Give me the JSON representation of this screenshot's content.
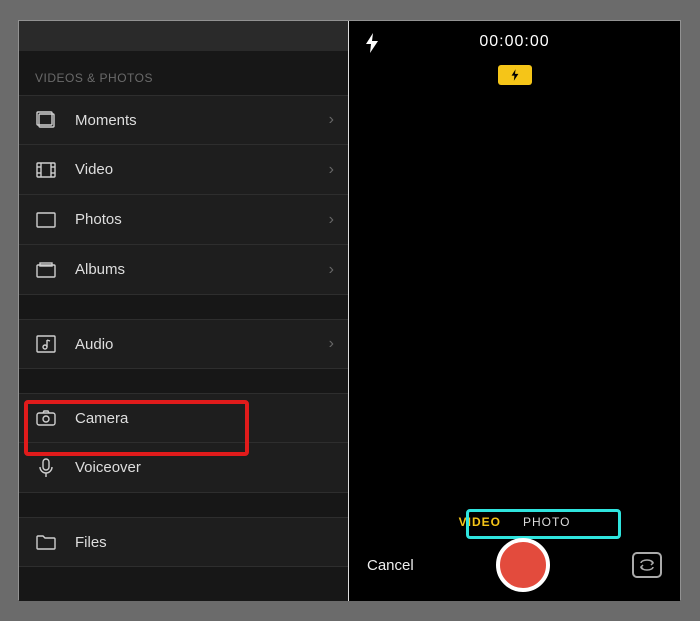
{
  "left": {
    "section_label": "VIDEOS & PHOTOS",
    "items": {
      "moments": "Moments",
      "video": "Video",
      "photos": "Photos",
      "albums": "Albums",
      "audio": "Audio",
      "camera": "Camera",
      "voiceover": "Voiceover",
      "files": "Files"
    }
  },
  "camera": {
    "timer": "00:00:00",
    "mode_video": "VIDEO",
    "mode_photo": "PHOTO",
    "cancel": "Cancel"
  }
}
